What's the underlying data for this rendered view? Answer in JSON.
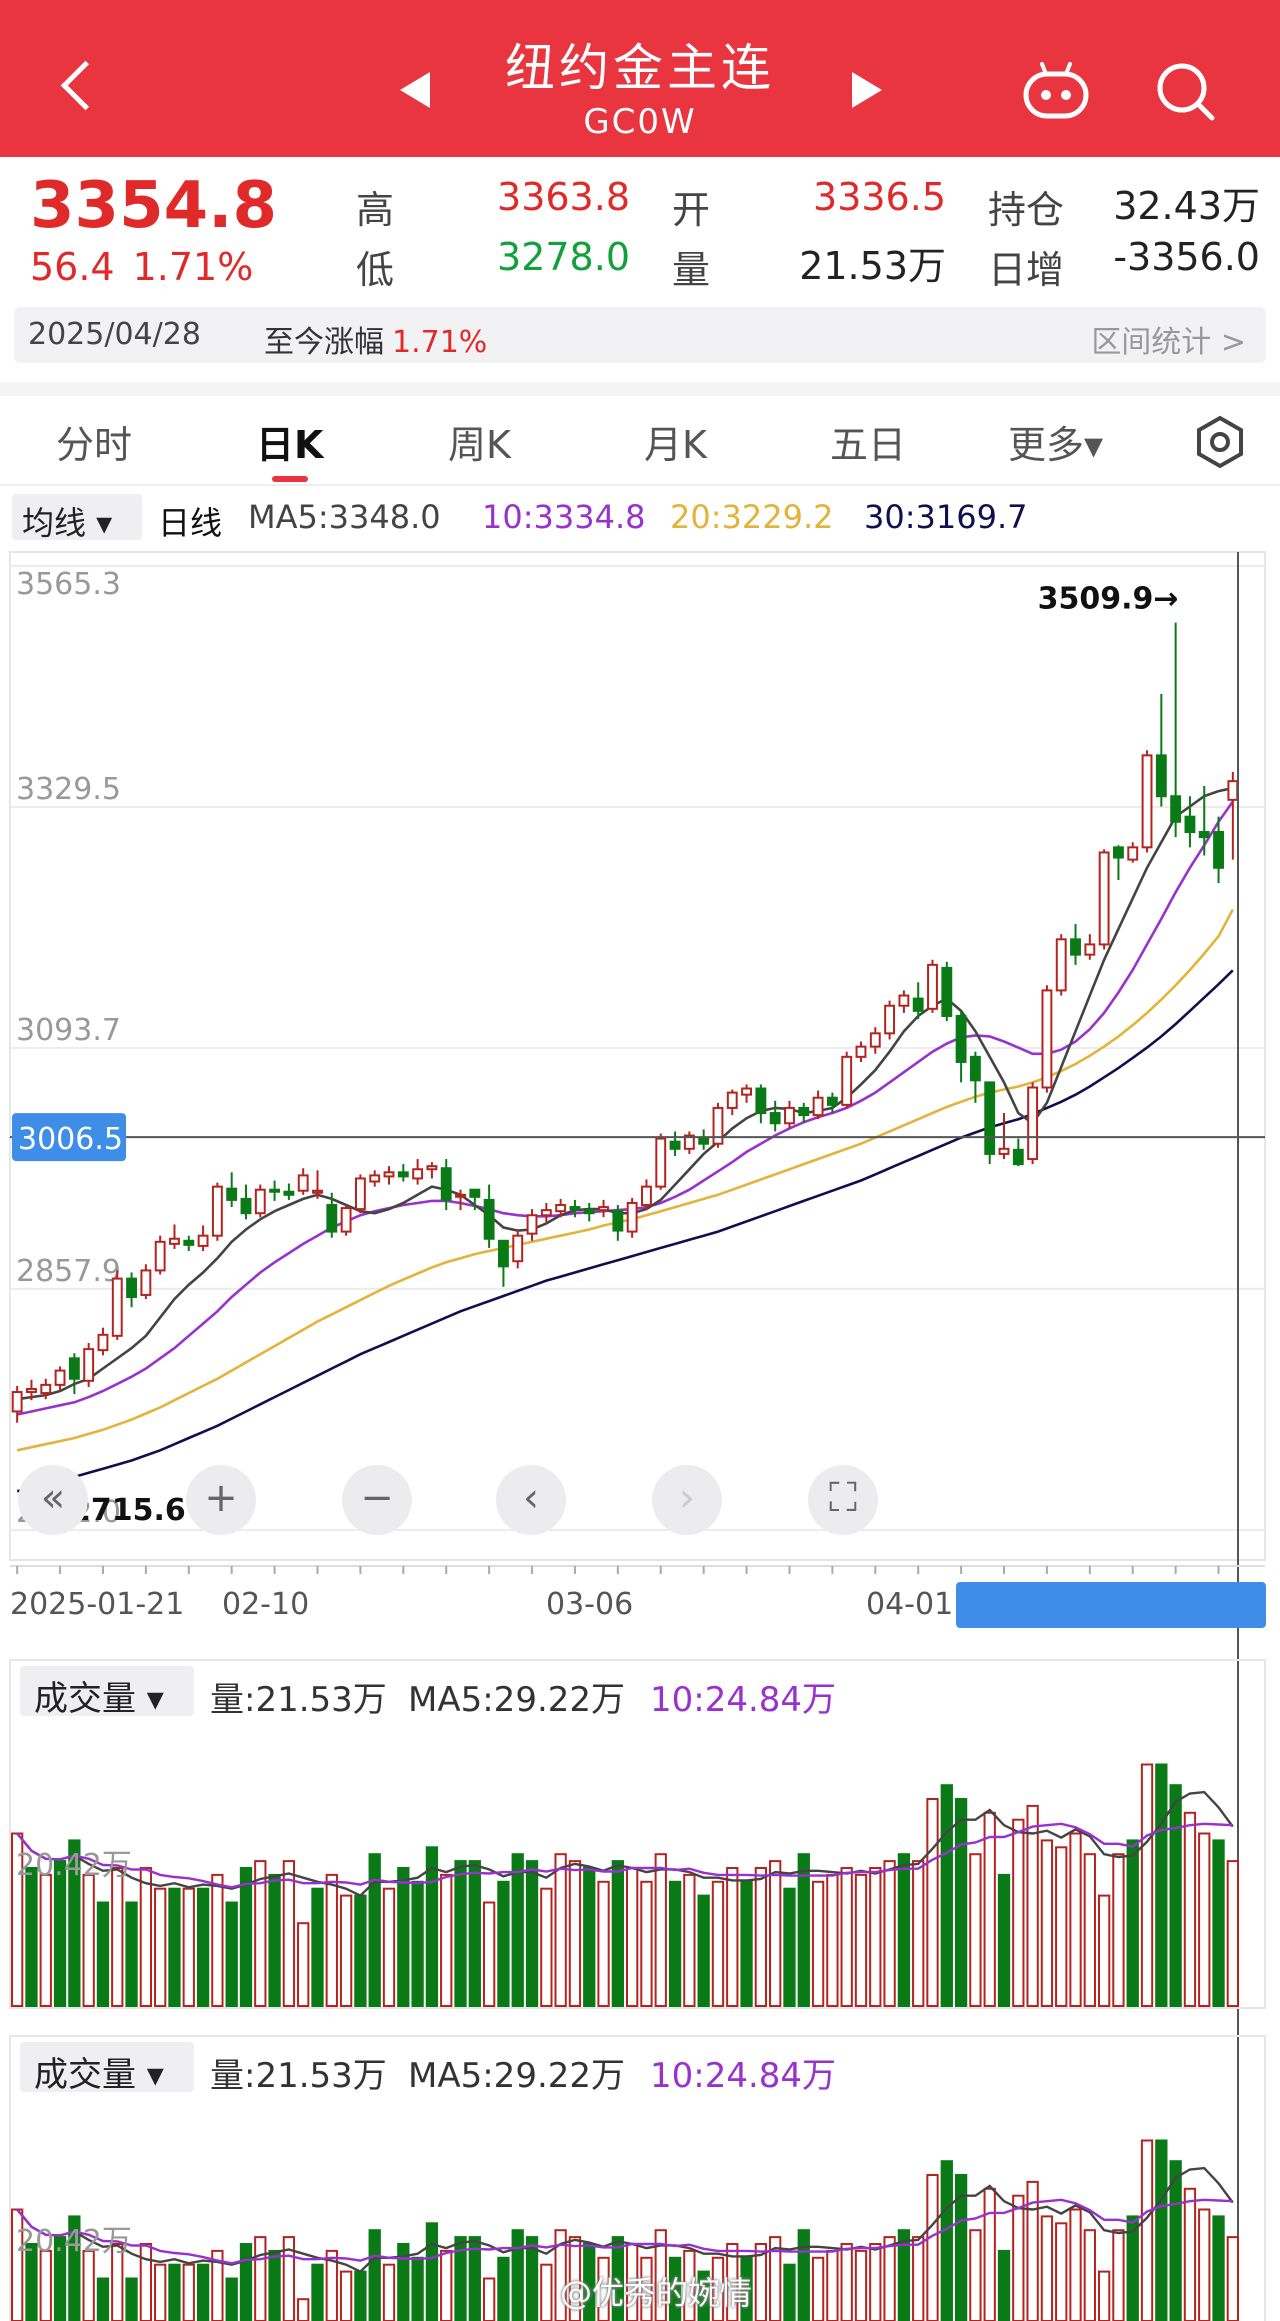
{
  "header": {
    "title": "纽约金主连",
    "subtitle": "GC0W"
  },
  "quote": {
    "price": "3354.8",
    "change": "56.4",
    "change_pct": "1.71%",
    "high_label": "高",
    "high": "3363.8",
    "low_label": "低",
    "low": "3278.0",
    "open_label": "开",
    "open": "3336.5",
    "volume_label": "量",
    "volume": "21.53万",
    "oi_label": "持仓",
    "oi": "32.43万",
    "daily_inc_label": "日增",
    "daily_inc": "-3356.0",
    "date": "2025/04/28",
    "since_label": "至今涨幅",
    "since_pct": "1.71%",
    "stat_label": "区间统计 >"
  },
  "tabs": [
    {
      "label": "分时"
    },
    {
      "label": "日K"
    },
    {
      "label": "周K"
    },
    {
      "label": "月K"
    },
    {
      "label": "五日"
    },
    {
      "label": "更多▾"
    }
  ],
  "ma_bar": {
    "selector": "均线 ▾",
    "line_type": "日线",
    "ma5": "MA5:3348.0",
    "ma10": "10:3334.8",
    "ma20": "20:3229.2",
    "ma30": "30:3169.7"
  },
  "volume_panel": {
    "selector": "成交量 ▾",
    "vol": "量:21.53万",
    "ma5": "MA5:29.22万",
    "ma10": "10:24.84万",
    "axis_label": "20.42万"
  },
  "watermark": "@优秀的婉情",
  "colors": {
    "up": "#b5231f",
    "down": "#0a7a17",
    "ma5": "#444444",
    "ma10": "#9932cc",
    "ma20": "#e3b33a",
    "ma30": "#101050",
    "header_bg": "#e9353f",
    "crosshair_label_bg": "#3e8ee8"
  },
  "chart_data": {
    "type": "candlestick",
    "ytick_labels": [
      "3565.3",
      "3329.5",
      "3093.7",
      "2857.9",
      "2622.0"
    ],
    "ylim": [
      2622.0,
      3565.3
    ],
    "xtick_labels": [
      "2025-01-21",
      "02-10",
      "03-06",
      "04-01"
    ],
    "max_label": "3509.9→",
    "min_label": "2715.6",
    "crosshair_label": "3006.5",
    "crosshair_value": 3006.5,
    "candles": [
      [
        2738,
        2757,
        2727,
        2763
      ],
      [
        2757,
        2760,
        2749,
        2769
      ],
      [
        2756,
        2764,
        2750,
        2770
      ],
      [
        2764,
        2778,
        2758,
        2782
      ],
      [
        2790,
        2770,
        2755,
        2795
      ],
      [
        2768,
        2799,
        2762,
        2805
      ],
      [
        2798,
        2813,
        2793,
        2820
      ],
      [
        2812,
        2868,
        2808,
        2876
      ],
      [
        2868,
        2850,
        2840,
        2874
      ],
      [
        2852,
        2876,
        2848,
        2882
      ],
      [
        2876,
        2904,
        2872,
        2910
      ],
      [
        2902,
        2907,
        2897,
        2921
      ],
      [
        2905,
        2901,
        2895,
        2910
      ],
      [
        2900,
        2910,
        2895,
        2920
      ],
      [
        2910,
        2958,
        2905,
        2962
      ],
      [
        2956,
        2945,
        2938,
        2972
      ],
      [
        2946,
        2932,
        2926,
        2960
      ],
      [
        2932,
        2955,
        2928,
        2960
      ],
      [
        2955,
        2953,
        2944,
        2964
      ],
      [
        2953,
        2950,
        2945,
        2961
      ],
      [
        2954,
        2969,
        2950,
        2976
      ],
      [
        2952,
        2954,
        2946,
        2974
      ],
      [
        2940,
        2914,
        2908,
        2952
      ],
      [
        2914,
        2937,
        2910,
        2940
      ],
      [
        2936,
        2966,
        2932,
        2970
      ],
      [
        2963,
        2969,
        2958,
        2974
      ],
      [
        2968,
        2972,
        2960,
        2978
      ],
      [
        2972,
        2968,
        2963,
        2980
      ],
      [
        2966,
        2975,
        2960,
        2985
      ],
      [
        2975,
        2978,
        2966,
        2982
      ],
      [
        2976,
        2945,
        2935,
        2985
      ],
      [
        2950,
        2950,
        2935,
        2955
      ],
      [
        2955,
        2948,
        2935,
        2955
      ],
      [
        2945,
        2907,
        2898,
        2960
      ],
      [
        2905,
        2880,
        2860,
        2905
      ],
      [
        2885,
        2910,
        2878,
        2915
      ],
      [
        2912,
        2930,
        2905,
        2936
      ],
      [
        2930,
        2935,
        2922,
        2942
      ],
      [
        2934,
        2940,
        2928,
        2946
      ],
      [
        2938,
        2936,
        2928,
        2945
      ],
      [
        2935,
        2932,
        2924,
        2942
      ],
      [
        2935,
        2938,
        2928,
        2945
      ],
      [
        2934,
        2915,
        2905,
        2940
      ],
      [
        2914,
        2942,
        2908,
        2947
      ],
      [
        2940,
        2958,
        2935,
        2965
      ],
      [
        2958,
        3005,
        2955,
        3010
      ],
      [
        3002,
        2995,
        2988,
        3012
      ],
      [
        2995,
        3008,
        2990,
        3012
      ],
      [
        3005,
        3000,
        2994,
        3014
      ],
      [
        3000,
        3035,
        2996,
        3040
      ],
      [
        3035,
        3050,
        3028,
        3053
      ],
      [
        3048,
        3054,
        3040,
        3058
      ],
      [
        3054,
        3030,
        3020,
        3058
      ],
      [
        3030,
        3020,
        3012,
        3042
      ],
      [
        3020,
        3035,
        3015,
        3042
      ],
      [
        3035,
        3028,
        3020,
        3040
      ],
      [
        3028,
        3045,
        3024,
        3052
      ],
      [
        3045,
        3038,
        3030,
        3050
      ],
      [
        3038,
        3085,
        3035,
        3090
      ],
      [
        3085,
        3095,
        3080,
        3100
      ],
      [
        3095,
        3108,
        3088,
        3114
      ],
      [
        3108,
        3135,
        3102,
        3140
      ],
      [
        3135,
        3145,
        3128,
        3150
      ],
      [
        3142,
        3130,
        3122,
        3158
      ],
      [
        3132,
        3175,
        3128,
        3180
      ],
      [
        3172,
        3125,
        3120,
        3178
      ],
      [
        3125,
        3080,
        3060,
        3130
      ],
      [
        3085,
        3062,
        3040,
        3090
      ],
      [
        3060,
        2990,
        2980,
        3060
      ],
      [
        2990,
        2995,
        2985,
        3030
      ],
      [
        2994,
        2980,
        2978,
        3005
      ],
      [
        2985,
        3055,
        2980,
        3060
      ],
      [
        3055,
        3150,
        3050,
        3155
      ],
      [
        3150,
        3200,
        3145,
        3205
      ],
      [
        3200,
        3185,
        3175,
        3215
      ],
      [
        3185,
        3195,
        3180,
        3205
      ],
      [
        3195,
        3285,
        3190,
        3288
      ],
      [
        3290,
        3280,
        3258,
        3292
      ],
      [
        3278,
        3290,
        3275,
        3295
      ],
      [
        3290,
        3380,
        3285,
        3385
      ],
      [
        3380,
        3340,
        3330,
        3440
      ],
      [
        3340,
        3315,
        3300,
        3509.9
      ],
      [
        3320,
        3305,
        3290,
        3340
      ],
      [
        3305,
        3300,
        3282,
        3350
      ],
      [
        3305,
        3270,
        3255,
        3320
      ],
      [
        3336.5,
        3354.8,
        3278.0,
        3363.8
      ]
    ],
    "volume": [
      [
        25,
        1
      ],
      [
        20,
        0
      ],
      [
        19,
        1
      ],
      [
        21,
        0
      ],
      [
        24,
        0
      ],
      [
        19,
        1
      ],
      [
        15,
        0
      ],
      [
        20,
        1
      ],
      [
        15,
        0
      ],
      [
        20,
        1
      ],
      [
        17,
        1
      ],
      [
        17,
        0
      ],
      [
        17,
        1
      ],
      [
        17,
        0
      ],
      [
        19,
        1
      ],
      [
        15,
        0
      ],
      [
        20,
        0
      ],
      [
        21,
        1
      ],
      [
        19,
        0
      ],
      [
        21,
        1
      ],
      [
        12,
        1
      ],
      [
        17,
        0
      ],
      [
        19,
        1
      ],
      [
        16,
        1
      ],
      [
        16,
        0
      ],
      [
        22,
        0
      ],
      [
        17,
        1
      ],
      [
        20,
        0
      ],
      [
        18,
        0
      ],
      [
        23,
        0
      ],
      [
        19,
        1
      ],
      [
        21,
        0
      ],
      [
        21,
        0
      ],
      [
        15,
        1
      ],
      [
        18,
        0
      ],
      [
        22,
        0
      ],
      [
        21,
        0
      ],
      [
        17,
        1
      ],
      [
        22,
        1
      ],
      [
        21,
        1
      ],
      [
        20,
        0
      ],
      [
        18,
        1
      ],
      [
        21,
        0
      ],
      [
        20,
        1
      ],
      [
        18,
        1
      ],
      [
        22,
        1
      ],
      [
        18,
        0
      ],
      [
        19,
        1
      ],
      [
        16,
        0
      ],
      [
        18,
        1
      ],
      [
        20,
        1
      ],
      [
        18,
        0
      ],
      [
        20,
        1
      ],
      [
        21,
        1
      ],
      [
        17,
        0
      ],
      [
        22,
        0
      ],
      [
        18,
        1
      ],
      [
        19,
        1
      ],
      [
        20,
        1
      ],
      [
        19,
        1
      ],
      [
        20,
        1
      ],
      [
        21,
        1
      ],
      [
        22,
        0
      ],
      [
        21,
        1
      ],
      [
        30,
        1
      ],
      [
        32,
        0
      ],
      [
        30,
        0
      ],
      [
        22,
        1
      ],
      [
        28,
        1
      ],
      [
        19,
        0
      ],
      [
        27,
        1
      ],
      [
        29,
        1
      ],
      [
        24,
        1
      ],
      [
        23,
        1
      ],
      [
        25,
        1
      ],
      [
        22,
        1
      ],
      [
        16,
        1
      ],
      [
        22,
        1
      ],
      [
        24,
        0
      ],
      [
        35,
        1
      ],
      [
        35,
        0
      ],
      [
        32,
        0
      ],
      [
        28,
        1
      ],
      [
        25,
        1
      ],
      [
        24,
        0
      ],
      [
        21,
        1
      ]
    ],
    "ma5": [
      2750,
      2752,
      2754,
      2758,
      2765,
      2770,
      2780,
      2790,
      2800,
      2812,
      2830,
      2848,
      2862,
      2874,
      2888,
      2904,
      2916,
      2926,
      2934,
      2940,
      2946,
      2950,
      2946,
      2940,
      2934,
      2932,
      2936,
      2942,
      2950,
      2958,
      2955,
      2950,
      2940,
      2930,
      2918,
      2915,
      2916,
      2922,
      2930,
      2935,
      2936,
      2936,
      2932,
      2932,
      2936,
      2945,
      2960,
      2975,
      2990,
      3002,
      3015,
      3025,
      3032,
      3035,
      3034,
      3030,
      3032,
      3035,
      3045,
      3058,
      3072,
      3090,
      3110,
      3125,
      3135,
      3142,
      3130,
      3110,
      3085,
      3060,
      3030,
      3020,
      3040,
      3075,
      3110,
      3145,
      3180,
      3210,
      3240,
      3270,
      3295,
      3320,
      3330,
      3340,
      3345,
      3348
    ],
    "ma10": [
      2735,
      2738,
      2741,
      2744,
      2747,
      2752,
      2758,
      2765,
      2772,
      2780,
      2790,
      2800,
      2812,
      2824,
      2836,
      2850,
      2862,
      2874,
      2884,
      2893,
      2902,
      2910,
      2918,
      2924,
      2930,
      2934,
      2937,
      2940,
      2942,
      2944,
      2944,
      2942,
      2939,
      2936,
      2932,
      2930,
      2929,
      2929,
      2930,
      2932,
      2933,
      2934,
      2935,
      2936,
      2938,
      2942,
      2948,
      2955,
      2964,
      2973,
      2982,
      2992,
      3000,
      3008,
      3015,
      3021,
      3026,
      3030,
      3035,
      3042,
      3050,
      3060,
      3070,
      3080,
      3090,
      3098,
      3104,
      3106,
      3105,
      3100,
      3094,
      3088,
      3088,
      3092,
      3100,
      3112,
      3128,
      3148,
      3170,
      3195,
      3220,
      3246,
      3270,
      3292,
      3315,
      3334.8
    ],
    "ma20": [
      2700,
      2703,
      2706,
      2709,
      2712,
      2716,
      2720,
      2725,
      2730,
      2736,
      2742,
      2749,
      2756,
      2763,
      2770,
      2778,
      2786,
      2794,
      2802,
      2810,
      2818,
      2826,
      2833,
      2840,
      2847,
      2854,
      2861,
      2867,
      2873,
      2879,
      2884,
      2888,
      2892,
      2895,
      2898,
      2901,
      2904,
      2907,
      2910,
      2913,
      2916,
      2920,
      2923,
      2926,
      2930,
      2934,
      2938,
      2942,
      2946,
      2950,
      2955,
      2960,
      2965,
      2970,
      2975,
      2980,
      2985,
      2990,
      2995,
      3000,
      3006,
      3012,
      3018,
      3024,
      3030,
      3036,
      3041,
      3046,
      3050,
      3053,
      3056,
      3060,
      3065,
      3071,
      3078,
      3086,
      3095,
      3105,
      3116,
      3128,
      3141,
      3155,
      3170,
      3186,
      3203,
      3229.2
    ],
    "ma30": [
      2660,
      2663,
      2666,
      2670,
      2674,
      2678,
      2682,
      2686,
      2690,
      2695,
      2700,
      2706,
      2712,
      2718,
      2724,
      2731,
      2738,
      2745,
      2752,
      2759,
      2766,
      2773,
      2780,
      2787,
      2794,
      2800,
      2806,
      2812,
      2818,
      2824,
      2830,
      2836,
      2841,
      2846,
      2851,
      2856,
      2861,
      2866,
      2870,
      2874,
      2878,
      2882,
      2886,
      2890,
      2894,
      2898,
      2902,
      2906,
      2910,
      2914,
      2919,
      2924,
      2929,
      2934,
      2939,
      2944,
      2949,
      2954,
      2959,
      2964,
      2970,
      2976,
      2982,
      2988,
      2994,
      3000,
      3006,
      3011,
      3016,
      3020,
      3024,
      3029,
      3035,
      3041,
      3048,
      3056,
      3065,
      3074,
      3084,
      3094,
      3105,
      3117,
      3130,
      3143,
      3156,
      3169.7
    ]
  }
}
